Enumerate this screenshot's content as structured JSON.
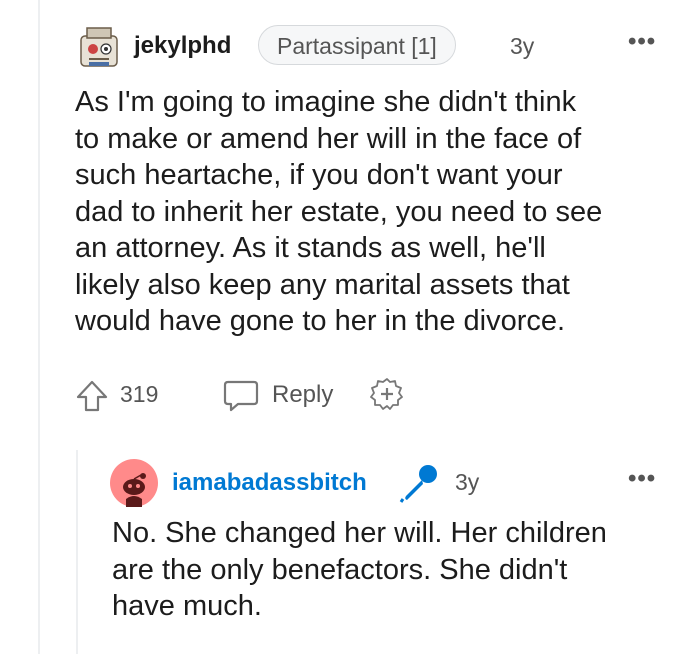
{
  "comment": {
    "username": "jekylphd",
    "flair": "Partassipant [1]",
    "time": "3y",
    "more": "•••",
    "body_lines": [
      "As I'm going to imagine she didn't think",
      "to make or amend her will in the face of",
      "such heartache, if you don't want your",
      "dad to inherit her estate, you need to see",
      "an attorney. As it stands as well, he'll",
      "likely also keep any marital assets that",
      "would have gone to her in the divorce."
    ],
    "votes": "319",
    "reply_label": "Reply",
    "avatar_icon": "user-avatar-icon",
    "upvote_icon": "upvote-arrow-icon",
    "reply_icon": "speech-bubble-icon",
    "award_icon": "add-award-icon"
  },
  "reply": {
    "username": "iamabadassbitch",
    "time": "3y",
    "more": "•••",
    "body_lines": [
      "No. She changed her will. Her children",
      "are the only benefactors. She didn't",
      "have much."
    ],
    "avatar_icon": "snoo-avatar-icon",
    "mod_icon": "microphone-icon"
  },
  "colors": {
    "username_reply": "#0079d3",
    "meta": "#555555",
    "thread_line": "#edeff1",
    "avatar_pink": "#ff8a8a"
  }
}
